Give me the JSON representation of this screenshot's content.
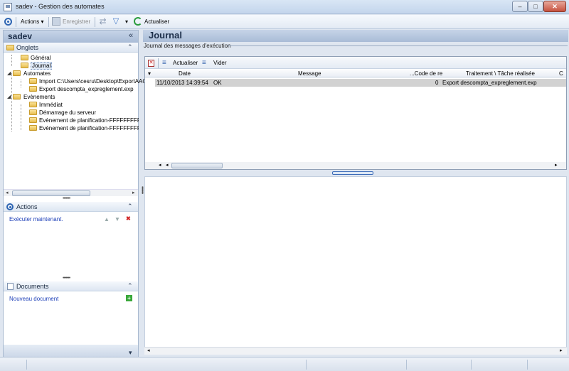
{
  "window": {
    "title": "sadev -  Gestion des automates",
    "min_glyph": "–",
    "max_glyph": "□",
    "close_glyph": "✕"
  },
  "toolbar": {
    "actions_label": "Actions",
    "actions_arrow": "▾",
    "save_label": "Enregistrer",
    "filter_arrow": "▾",
    "refresh_label": "Actualiser"
  },
  "left_panel": {
    "header": "sadev",
    "collapse_glyph": "«",
    "tabs_section": {
      "label": "Onglets",
      "toggle_glyph": "⌃"
    },
    "tree": [
      {
        "label": "Général",
        "level": 1,
        "expanded": null,
        "selected": false
      },
      {
        "label": "Journal",
        "level": 1,
        "expanded": null,
        "selected": true
      },
      {
        "label": "Automates",
        "level": 0,
        "expanded": true,
        "selected": false
      },
      {
        "label": "Import C:\\Users\\cesru\\Desktop\\ExportAAC",
        "level": 1,
        "expanded": null,
        "selected": false
      },
      {
        "label": "Export descompta_expreglement.exp",
        "level": 1,
        "expanded": null,
        "selected": false
      },
      {
        "label": "Evènements",
        "level": 0,
        "expanded": true,
        "selected": false
      },
      {
        "label": "Immédiat",
        "level": 1,
        "expanded": null,
        "selected": false
      },
      {
        "label": "Démarrage du serveur",
        "level": 1,
        "expanded": null,
        "selected": false
      },
      {
        "label": "Evènement de planification-FFFFFFFFFFF",
        "level": 1,
        "expanded": null,
        "selected": false
      },
      {
        "label": "Evènement de planification-FFFFFFFFFFF",
        "level": 1,
        "expanded": null,
        "selected": false
      }
    ],
    "actions_section": {
      "label": "Actions",
      "toggle_glyph": "⌃",
      "link": "Exécuter maintenant."
    },
    "documents_section": {
      "label": "Documents",
      "toggle_glyph": "⌃",
      "link": "Nouveau document"
    },
    "bottom_chevron": "▾"
  },
  "journal": {
    "title": "Journal",
    "subtitle": "Journal des messages d'exécution",
    "toolbar": {
      "refresh_label": "Actualiser",
      "clear_label": "Vider"
    },
    "columns": [
      "Date",
      "Message",
      "...Code de re",
      "Traitement \\ Tâche réalisée",
      "C"
    ],
    "rows": [
      {
        "date": "11/10/2013 14:39:54",
        "message": "OK",
        "code": "0",
        "task": "Export descompta_expreglement.exp"
      }
    ]
  },
  "colors": {
    "accent": "#2f66b3",
    "link": "#1d3fb8",
    "header_gradient": "#a9bcd7",
    "selected_row": "#d2d2d2",
    "close_button": "#c6513e"
  }
}
